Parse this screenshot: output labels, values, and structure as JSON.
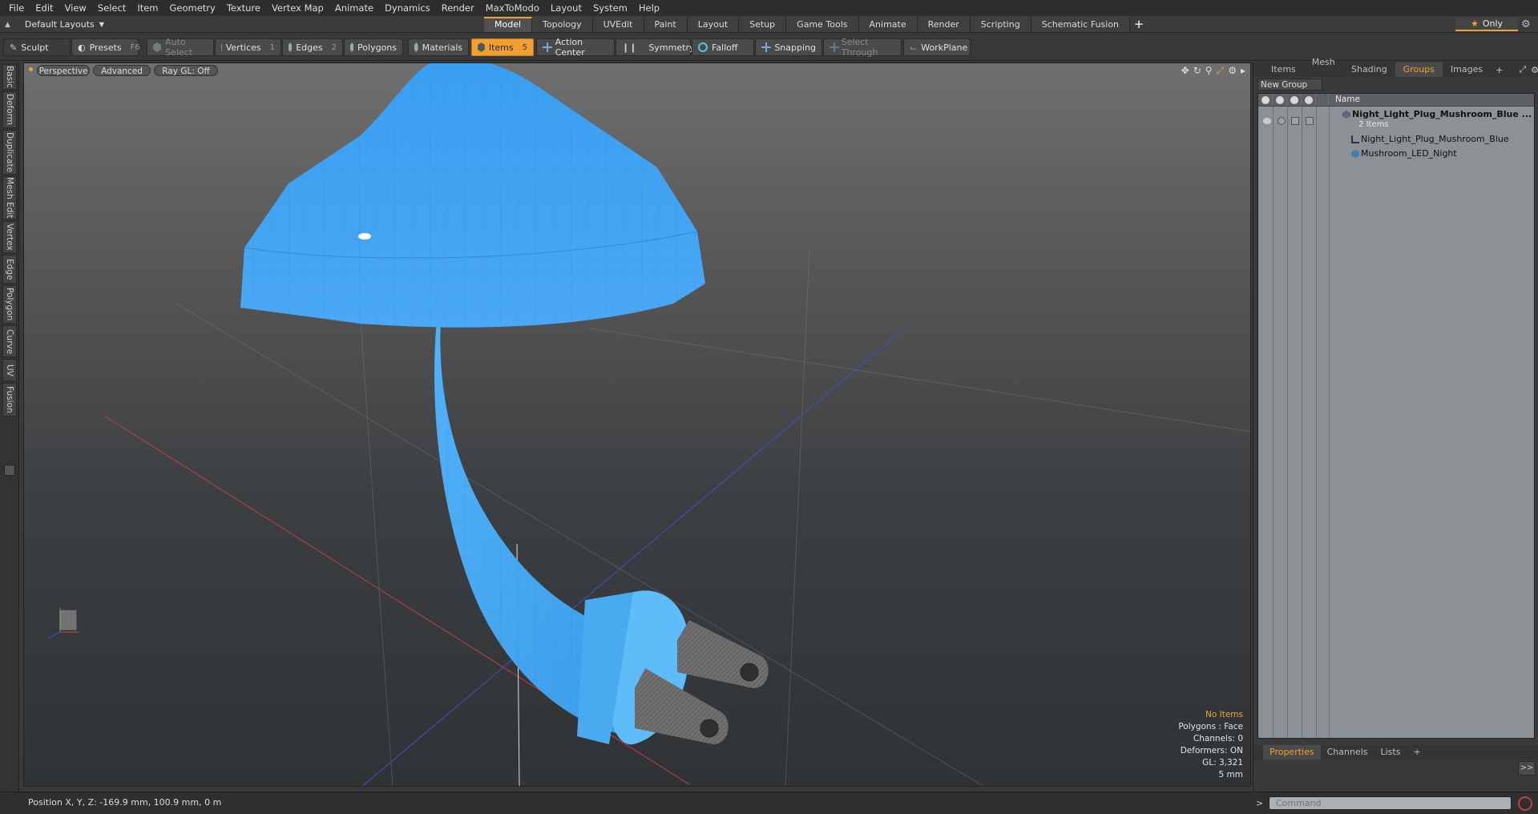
{
  "menu": [
    "File",
    "Edit",
    "View",
    "Select",
    "Item",
    "Geometry",
    "Texture",
    "Vertex Map",
    "Animate",
    "Dynamics",
    "Render",
    "MaxToModo",
    "Layout",
    "System",
    "Help"
  ],
  "layout": {
    "label": "Default Layouts",
    "only": "Only"
  },
  "layout_tabs": [
    "Model",
    "Topology",
    "UVEdit",
    "Paint",
    "Layout",
    "Setup",
    "Game Tools",
    "Animate",
    "Render",
    "Scripting",
    "Schematic Fusion"
  ],
  "layout_active": "Model",
  "toolbar": {
    "sculpt": "Sculpt",
    "presets": "Presets",
    "presets_key": "F6",
    "auto_select": "Auto Select",
    "vertices": "Vertices",
    "vertices_key": "1",
    "edges": "Edges",
    "edges_key": "2",
    "polygons": "Polygons",
    "materials": "Materials",
    "items": "Items",
    "items_key": "5",
    "action_center": "Action Center",
    "symmetry": "Symmetry",
    "falloff": "Falloff",
    "snapping": "Snapping",
    "select_through": "Select Through",
    "workplane": "WorkPlane"
  },
  "left_tabs": [
    "Basic",
    "Deform",
    "Duplicate",
    "Mesh Edit",
    "Vertex",
    "Edge",
    "Polygon",
    "Curve",
    "UV",
    "Fusion"
  ],
  "viewport": {
    "view": "Perspective",
    "shading": "Advanced",
    "raygl": "Ray GL: Off",
    "info": {
      "no_items": "No Items",
      "polygons": "Polygons : Face",
      "channels": "Channels: 0",
      "deformers": "Deformers: ON",
      "gl": "GL: 3,321",
      "scale": "5 mm"
    },
    "colors": {
      "mesh": "#3ea6f5",
      "plug": "#6f6f6f"
    }
  },
  "right_panel": {
    "tabs": [
      "Items",
      "Mesh ...",
      "Shading",
      "Groups",
      "Images"
    ],
    "active_tab": "Groups",
    "new_group": "New Group",
    "col_name": "Name",
    "groups": {
      "root": "Night_Light_Plug_Mushroom_Blue ...",
      "root_count": "2 Items",
      "children": [
        "Night_Light_Plug_Mushroom_Blue",
        "Mushroom_LED_Night"
      ]
    },
    "bottom_tabs": [
      "Properties",
      "Channels",
      "Lists"
    ],
    "bottom_active": "Properties",
    "expand": ">>"
  },
  "status": {
    "position": "Position X, Y, Z:  -169.9 mm, 100.9 mm, 0 m",
    "command_placeholder": "Command"
  }
}
